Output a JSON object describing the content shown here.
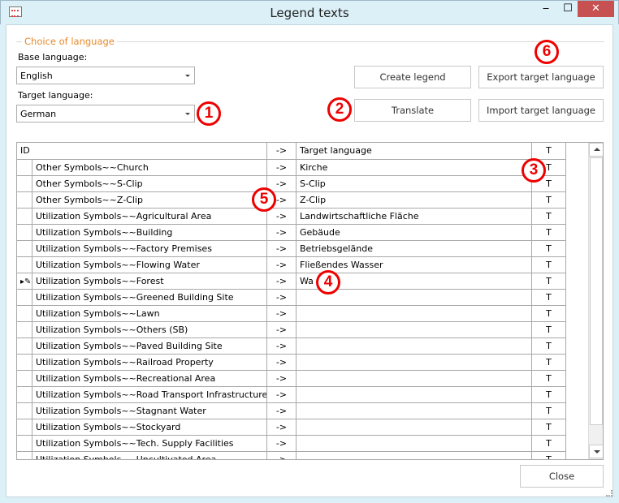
{
  "window": {
    "title": "Legend texts",
    "minimize": "‒",
    "maximize": "☐",
    "close": "✕"
  },
  "group": {
    "title": "Choice of language"
  },
  "base_language": {
    "label": "Base language:",
    "value": "English"
  },
  "target_language": {
    "label": "Target language:",
    "value": "German"
  },
  "buttons": {
    "create_legend": "Create legend",
    "translate": "Translate",
    "export": "Export target language",
    "import": "Import target language",
    "close": "Close"
  },
  "grid": {
    "headers": {
      "id": "ID",
      "arrow": "->",
      "target": "Target language",
      "t": "T"
    },
    "rows": [
      {
        "id": "Other Symbols~~Church",
        "arrow": "->",
        "target": "Kirche",
        "t": "T"
      },
      {
        "id": "Other Symbols~~S-Clip",
        "arrow": "->",
        "target": "S-Clip",
        "t": "T"
      },
      {
        "id": "Other Symbols~~Z-Clip",
        "arrow": "->",
        "target": "Z-Clip",
        "t": "T"
      },
      {
        "id": "Utilization Symbols~~Agricultural Area",
        "arrow": "->",
        "target": "Landwirtschaftliche Fläche",
        "t": "T"
      },
      {
        "id": "Utilization Symbols~~Building",
        "arrow": "->",
        "target": "Gebäude",
        "t": "T"
      },
      {
        "id": "Utilization Symbols~~Factory Premises",
        "arrow": "->",
        "target": "Betriebsgelände",
        "t": "T"
      },
      {
        "id": "Utilization Symbols~~Flowing Water",
        "arrow": "->",
        "target": "Fließendes Wasser",
        "t": "T"
      },
      {
        "id": "Utilization Symbols~~Forest",
        "arrow": "->",
        "target": "Wa",
        "t": "T",
        "editing": true
      },
      {
        "id": "Utilization Symbols~~Greened Building Site",
        "arrow": "->",
        "target": "",
        "t": "T"
      },
      {
        "id": "Utilization Symbols~~Lawn",
        "arrow": "->",
        "target": "",
        "t": "T"
      },
      {
        "id": "Utilization Symbols~~Others (SB)",
        "arrow": "->",
        "target": "",
        "t": "T"
      },
      {
        "id": "Utilization Symbols~~Paved Building Site",
        "arrow": "->",
        "target": "",
        "t": "T"
      },
      {
        "id": "Utilization Symbols~~Railroad Property",
        "arrow": "->",
        "target": "",
        "t": "T"
      },
      {
        "id": "Utilization Symbols~~Recreational Area",
        "arrow": "->",
        "target": "",
        "t": "T"
      },
      {
        "id": "Utilization Symbols~~Road Transport Infrastructure",
        "arrow": "->",
        "target": "",
        "t": "T"
      },
      {
        "id": "Utilization Symbols~~Stagnant Water",
        "arrow": "->",
        "target": "",
        "t": "T"
      },
      {
        "id": "Utilization Symbols~~Stockyard",
        "arrow": "->",
        "target": "",
        "t": "T"
      },
      {
        "id": "Utilization Symbols~~Tech. Supply Facilities",
        "arrow": "->",
        "target": "",
        "t": "T"
      },
      {
        "id": "Utilization Symbols~~Uncultivated Area",
        "arrow": "->",
        "target": "",
        "t": "T"
      }
    ]
  },
  "callouts": [
    "1",
    "2",
    "3",
    "4",
    "5",
    "6"
  ],
  "colors": {
    "accent": "#e8892a",
    "callout": "#e00000",
    "close_button": "#c75050"
  }
}
